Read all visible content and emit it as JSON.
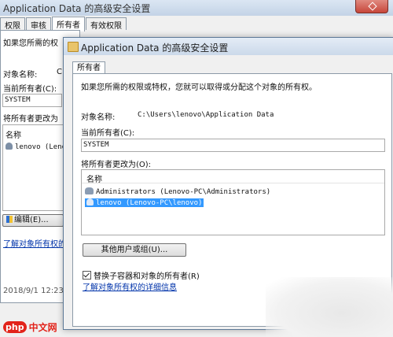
{
  "bg_window": {
    "title": "Application Data 的高级安全设置",
    "tabs": [
      "权限",
      "审核",
      "所有者",
      "有效权限"
    ],
    "intro": "如果您所需的权",
    "object_label": "对象名称:",
    "object_value_partial": "C",
    "current_owner_label": "当前所有者(C):",
    "current_owner_value": "SYSTEM",
    "change_owner_label": "将所有者更改为",
    "name_header": "名称",
    "list_item": "lenovo (Leno",
    "edit_button": "编辑(E)...",
    "learn_link": "了解对象所有权的",
    "timestamp": "2018/9/1 12:23"
  },
  "fg_window": {
    "title": "Application Data 的高级安全设置",
    "tab": "所有者",
    "intro": "如果您所需的权限或特权，您就可以取得或分配这个对象的所有权。",
    "object_label": "对象名称:",
    "object_value": "C:\\Users\\lenovo\\Application Data",
    "current_owner_label": "当前所有者(C):",
    "current_owner_value": "SYSTEM",
    "change_owner_label": "将所有者更改为(O):",
    "name_header": "名称",
    "owners": [
      "Administrators (Lenovo-PC\\Administrators)",
      "lenovo (Lenovo-PC\\lenovo)"
    ],
    "other_users_button": "其他用户或组(U)...",
    "replace_checkbox": "替换子容器和对象的所有者(R)",
    "learn_link": "了解对象所有权的详细信息"
  },
  "watermark": {
    "brand": "php",
    "site": "中文网"
  },
  "colors": {
    "selection": "#3399ff",
    "link": "#0033aa"
  }
}
